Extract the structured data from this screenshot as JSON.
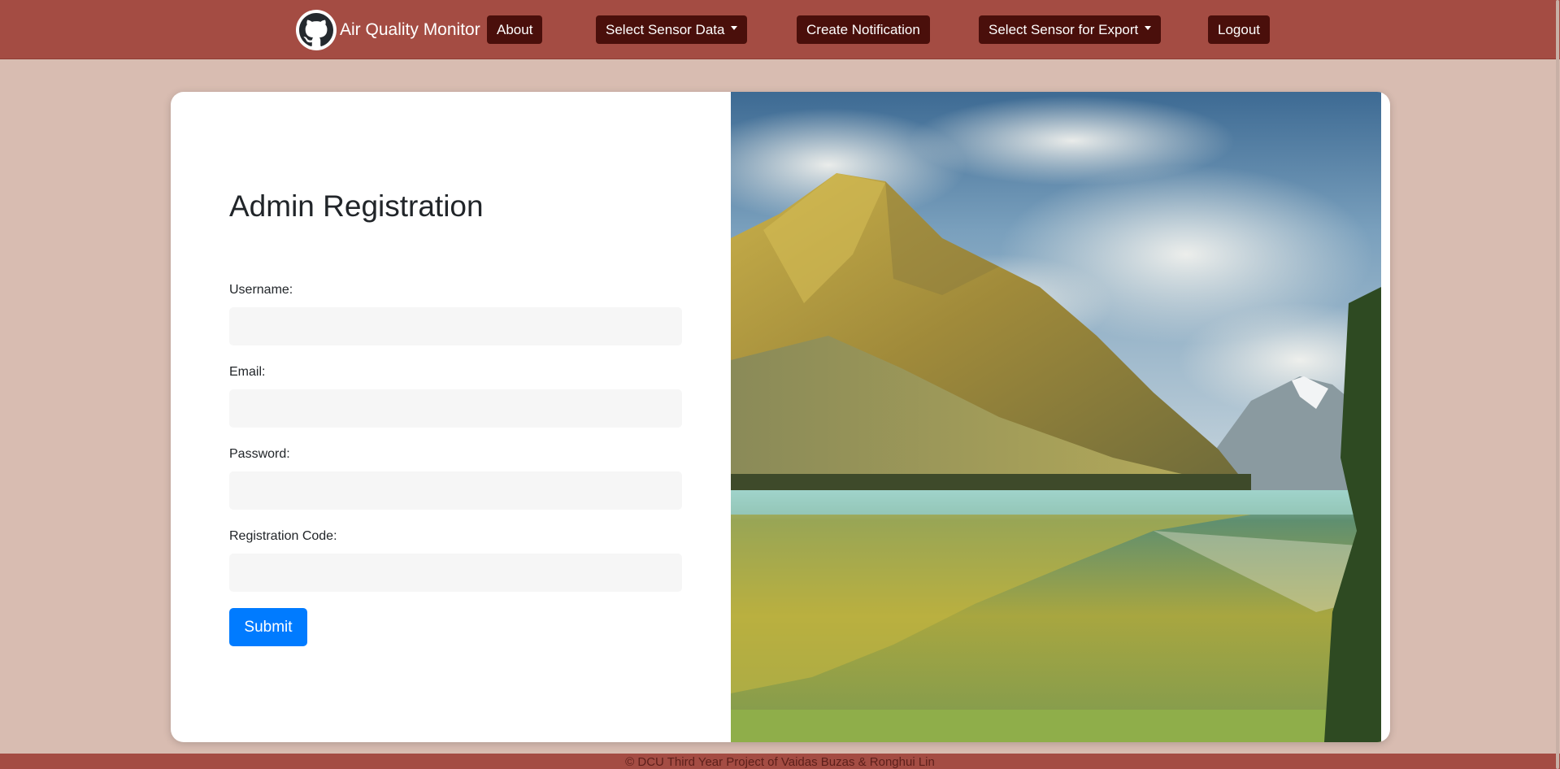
{
  "navbar": {
    "brand": "Air Quality Monitor",
    "logo_icon": "github-octocat-icon",
    "about_label": "About",
    "sensor_data_label": "Select Sensor Data",
    "notification_label": "Create Notification",
    "export_label": "Select Sensor for Export",
    "logout_label": "Logout"
  },
  "form": {
    "title": "Admin Registration",
    "username_label": "Username:",
    "username_value": "",
    "email_label": "Email:",
    "email_value": "",
    "password_label": "Password:",
    "password_value": "",
    "code_label": "Registration Code:",
    "code_value": "",
    "submit_label": "Submit"
  },
  "photo": {
    "subject": "mountain-lake-landscape"
  },
  "footer": {
    "text": "© DCU Third Year Project of Vaidas Buzas & Ronghui Lin"
  },
  "colors": {
    "navbar_bg": "#a44c43",
    "page_bg": "#d8bcb1",
    "nav_button_bg": "#4a0f0b",
    "submit_bg": "#007bff",
    "input_bg": "#f6f6f6"
  }
}
